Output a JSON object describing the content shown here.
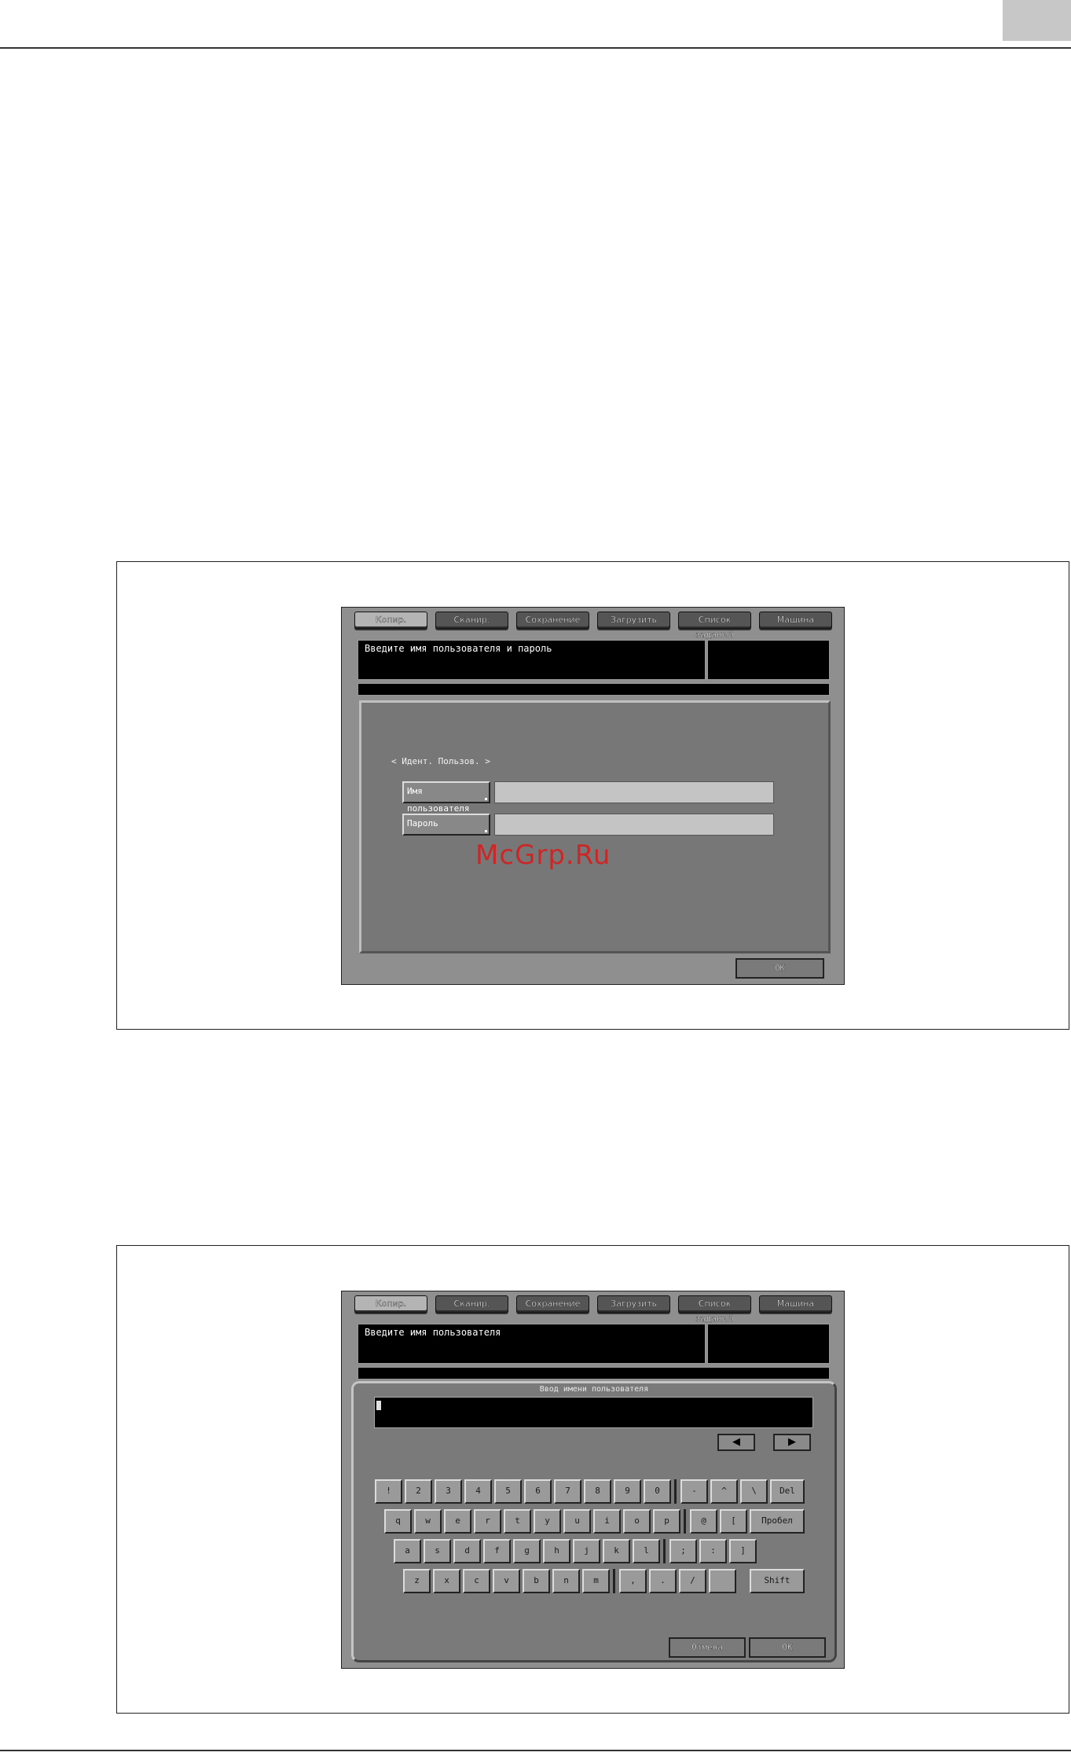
{
  "screen1": {
    "tabs": [
      "Копир.",
      "Сканир.",
      "Сохранение",
      "Загрузить",
      "Список заданий",
      "Машина"
    ],
    "message": "Введите имя пользователя и пароль",
    "section_heading": "< Идент. Пользов. >",
    "username_label": "Имя пользователя",
    "username_value": "",
    "password_label": "Пароль",
    "password_value": "",
    "ok_label": "OK",
    "watermark": "McGrp.Ru"
  },
  "screen2": {
    "tabs": [
      "Копир.",
      "Сканир.",
      "Сохранение",
      "Загрузить",
      "Список заданий",
      "Машина"
    ],
    "message": "Введите имя пользователя",
    "keyboard_title": "Ввод имени пользователя",
    "input_value": "",
    "left_arrow": "◀",
    "right_arrow": "▶",
    "rows": [
      [
        "!",
        "2",
        "3",
        "4",
        "5",
        "6",
        "7",
        "8",
        "9",
        "0",
        "-",
        "^",
        "\\",
        "Del"
      ],
      [
        "q",
        "w",
        "e",
        "r",
        "t",
        "y",
        "u",
        "i",
        "o",
        "p",
        "@",
        "[",
        "Пробел"
      ],
      [
        "a",
        "s",
        "d",
        "f",
        "g",
        "h",
        "j",
        "k",
        "l",
        ";",
        ":",
        "]"
      ],
      [
        "z",
        "x",
        "c",
        "v",
        "b",
        "n",
        "m",
        ",",
        ".",
        "/",
        "",
        "Shift"
      ]
    ],
    "cancel_label": "Отмена",
    "ok_label": "OK"
  }
}
